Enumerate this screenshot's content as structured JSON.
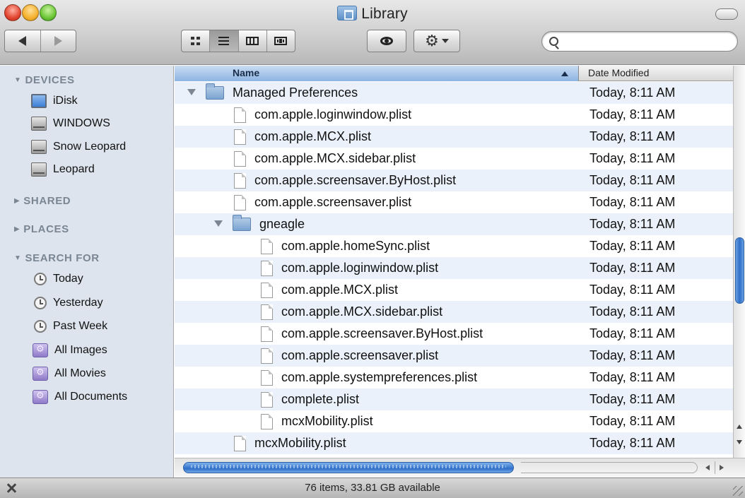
{
  "window": {
    "title": "Library"
  },
  "toolbar": {
    "search_placeholder": "",
    "search_value": ""
  },
  "sidebar": {
    "devices_header": "DEVICES",
    "devices": [
      "iDisk",
      "WINDOWS",
      "Snow Leopard",
      "Leopard"
    ],
    "shared_header": "SHARED",
    "places_header": "PLACES",
    "search_header": "SEARCH FOR",
    "searches": [
      "Today",
      "Yesterday",
      "Past Week",
      "All Images",
      "All Movies",
      "All Documents"
    ]
  },
  "list": {
    "columns": {
      "name": "Name",
      "date": "Date Modified"
    },
    "rows": [
      {
        "name": "Managed Preferences",
        "date": "Today, 8:11 AM",
        "kind": "folder",
        "expanded": true,
        "depth": 0
      },
      {
        "name": "com.apple.loginwindow.plist",
        "date": "Today, 8:11 AM",
        "kind": "file",
        "depth": 1
      },
      {
        "name": "com.apple.MCX.plist",
        "date": "Today, 8:11 AM",
        "kind": "file",
        "depth": 1
      },
      {
        "name": "com.apple.MCX.sidebar.plist",
        "date": "Today, 8:11 AM",
        "kind": "file",
        "depth": 1
      },
      {
        "name": "com.apple.screensaver.ByHost.plist",
        "date": "Today, 8:11 AM",
        "kind": "file",
        "depth": 1
      },
      {
        "name": "com.apple.screensaver.plist",
        "date": "Today, 8:11 AM",
        "kind": "file",
        "depth": 1
      },
      {
        "name": "gneagle",
        "date": "Today, 8:11 AM",
        "kind": "folder",
        "expanded": true,
        "depth": 1
      },
      {
        "name": "com.apple.homeSync.plist",
        "date": "Today, 8:11 AM",
        "kind": "file",
        "depth": 2
      },
      {
        "name": "com.apple.loginwindow.plist",
        "date": "Today, 8:11 AM",
        "kind": "file",
        "depth": 2
      },
      {
        "name": "com.apple.MCX.plist",
        "date": "Today, 8:11 AM",
        "kind": "file",
        "depth": 2
      },
      {
        "name": "com.apple.MCX.sidebar.plist",
        "date": "Today, 8:11 AM",
        "kind": "file",
        "depth": 2
      },
      {
        "name": "com.apple.screensaver.ByHost.plist",
        "date": "Today, 8:11 AM",
        "kind": "file",
        "depth": 2
      },
      {
        "name": "com.apple.screensaver.plist",
        "date": "Today, 8:11 AM",
        "kind": "file",
        "depth": 2
      },
      {
        "name": "com.apple.systempreferences.plist",
        "date": "Today, 8:11 AM",
        "kind": "file",
        "depth": 2
      },
      {
        "name": "complete.plist",
        "date": "Today, 8:11 AM",
        "kind": "file",
        "depth": 2
      },
      {
        "name": "mcxMobility.plist",
        "date": "Today, 8:11 AM",
        "kind": "file",
        "depth": 2
      },
      {
        "name": "mcxMobility.plist",
        "date": "Today, 8:11 AM",
        "kind": "file",
        "depth": 1
      }
    ]
  },
  "status": {
    "text": "76 items, 33.81 GB available"
  },
  "icons": {
    "window_title": "library-folder-icon",
    "back": "back-arrow-icon",
    "forward": "forward-arrow-icon",
    "view_icons": "icon-view-icon",
    "view_list": "list-view-icon",
    "view_columns": "column-view-icon",
    "view_coverflow": "cover-flow-icon",
    "quicklook": "eye-icon",
    "action": "gear-icon",
    "search": "search-icon",
    "status_left": "pencil-disabled-icon"
  }
}
